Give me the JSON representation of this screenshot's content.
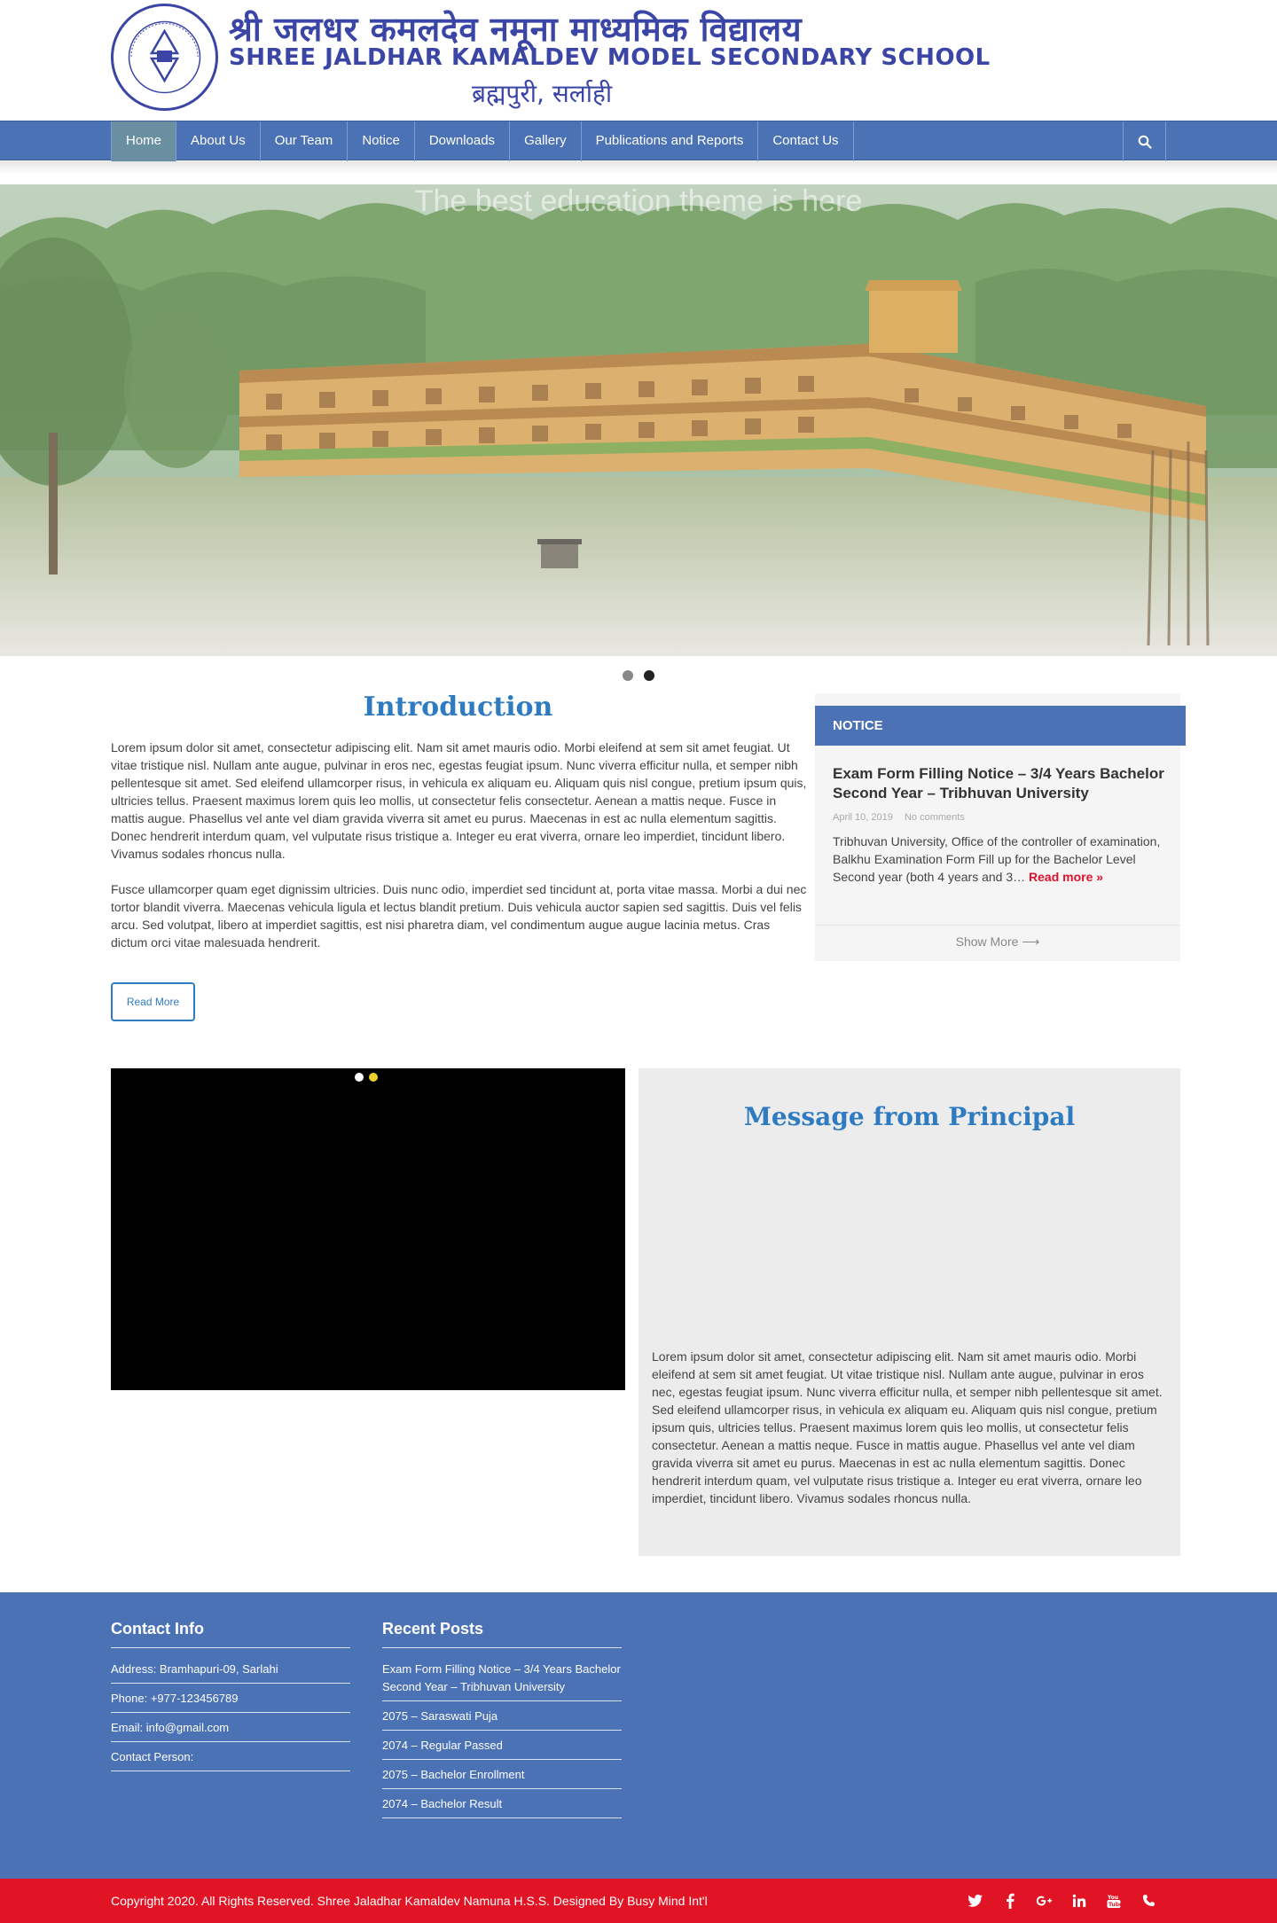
{
  "header": {
    "title_np": "श्री जलधर कमलदेव नमूना माध्यमिक विद्यालय",
    "title_en": "SHREE JALDHAR KAMALDEV MODEL SECONDARY SCHOOL",
    "location": "ब्रह्मपुरी, सर्लाही"
  },
  "nav": {
    "items": [
      {
        "label": "Home"
      },
      {
        "label": "About Us"
      },
      {
        "label": "Our Team"
      },
      {
        "label": "Notice"
      },
      {
        "label": "Downloads"
      },
      {
        "label": "Gallery"
      },
      {
        "label": "Publications and Reports"
      },
      {
        "label": "Contact Us"
      }
    ],
    "active": "Home",
    "search_icon": "search-icon"
  },
  "hero": {
    "tagline": "The best education theme is here",
    "slide_count": 2,
    "active_slide": 2
  },
  "intro": {
    "title": "Introduction",
    "paragraph1": "Lorem ipsum dolor sit amet, consectetur adipiscing elit. Nam sit amet mauris odio. Morbi eleifend at sem sit amet feugiat. Ut vitae tristique nisl. Nullam ante augue, pulvinar in eros nec, egestas feugiat ipsum. Nunc viverra efficitur nulla, et semper nibh pellentesque sit amet. Sed eleifend ullamcorper risus, in vehicula ex aliquam eu. Aliquam quis nisl congue, pretium ipsum quis, ultricies tellus. Praesent maximus lorem quis leo mollis, ut consectetur felis consectetur. Aenean a mattis neque. Fusce in mattis augue. Phasellus vel ante vel diam gravida viverra sit amet eu purus. Maecenas in est ac nulla elementum sagittis. Donec hendrerit interdum quam, vel vulputate risus tristique a. Integer eu erat viverra, ornare leo imperdiet, tincidunt libero. Vivamus sodales rhoncus nulla.",
    "paragraph2": "Fusce ullamcorper quam eget dignissim ultricies. Duis nunc odio, imperdiet sed tincidunt at, porta vitae massa. Morbi a dui nec tortor blandit viverra. Maecenas vehicula ligula et lectus blandit pretium. Duis vehicula auctor sapien sed sagittis. Duis vel felis arcu. Sed volutpat, libero at imperdiet sagittis, est nisi pharetra diam, vel condimentum augue augue lacinia metus. Cras dictum orci vitae malesuada hendrerit.",
    "read_more": "Read More"
  },
  "notice": {
    "heading": "NOTICE",
    "post_title": "Exam Form Filling Notice – 3/4 Years Bachelor Second Year – Tribhuvan University",
    "date": "April 10, 2019",
    "comments": "No comments",
    "excerpt": "Tribhuvan University, Office of the controller of examination, Balkhu Examination Form Fill up for the Bachelor Level Second year (both 4 years and 3…",
    "read_more": "Read more »",
    "show_more": "Show More ⟶"
  },
  "video": {
    "slide_count": 2,
    "active_slide": 2
  },
  "principal": {
    "title": "Message from Principal",
    "text": "Lorem ipsum dolor sit amet, consectetur adipiscing elit. Nam sit amet mauris odio. Morbi eleifend at sem sit amet feugiat. Ut vitae tristique nisl. Nullam ante augue, pulvinar in eros nec, egestas feugiat ipsum. Nunc viverra efficitur nulla, et semper nibh pellentesque sit amet. Sed eleifend ullamcorper risus, in vehicula ex aliquam eu. Aliquam quis nisl congue, pretium ipsum quis, ultricies tellus. Praesent maximus lorem quis leo mollis, ut consectetur felis consectetur. Aenean a mattis neque. Fusce in mattis augue. Phasellus vel ante vel diam gravida viverra sit amet eu purus. Maecenas in est ac nulla elementum sagittis. Donec hendrerit interdum quam, vel vulputate risus tristique a. Integer eu erat viverra, ornare leo imperdiet, tincidunt libero. Vivamus sodales rhoncus nulla."
  },
  "footer": {
    "contact": {
      "heading": "Contact Info",
      "items": [
        "Address: Bramhapuri-09, Sarlahi",
        "Phone: +977-123456789",
        "Email: info@gmail.com",
        "Contact Person:"
      ]
    },
    "recent": {
      "heading": "Recent Posts",
      "items": [
        "Exam Form Filling Notice – 3/4 Years Bachelor Second Year – Tribhuvan University",
        "2075 – Saraswati Puja",
        "2074 – Regular Passed",
        "2075 – Bachelor Enrollment",
        "2074 – Bachelor Result"
      ]
    },
    "copyright": "Copyright 2020. All Rights Reserved. Shree Jaladhar Kamaldev Namuna H.S.S. Designed By Busy Mind Int'l",
    "socials": [
      "twitter-icon",
      "facebook-icon",
      "google-plus-icon",
      "linkedin-icon",
      "youtube-icon",
      "phone-icon"
    ]
  },
  "colors": {
    "brand_blue": "#4c72b6",
    "heading_blue": "#2f7bc2",
    "logo_blue": "#3b45a6",
    "footer_red": "#e01424",
    "read_more_red": "#e0112c"
  }
}
